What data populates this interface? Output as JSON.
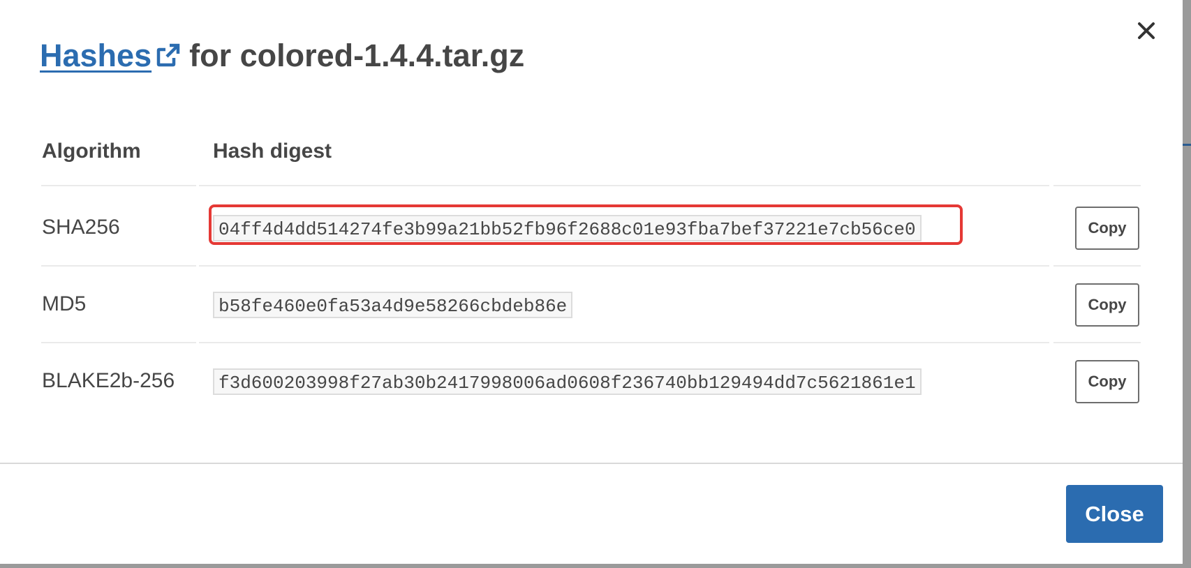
{
  "modal": {
    "title_link": "Hashes",
    "title_rest": "for colored-1.4.4.tar.gz",
    "close_icon": "close-icon",
    "external_link_icon": "external-link-icon"
  },
  "table": {
    "headers": [
      "Algorithm",
      "Hash digest"
    ],
    "rows": [
      {
        "algorithm": "SHA256",
        "digest": "04ff4d4dd514274fe3b99a21bb52fb96f2688c01e93fba7bef37221e7cb56ce0",
        "copy_label": "Copy",
        "highlighted": true
      },
      {
        "algorithm": "MD5",
        "digest": "b58fe460e0fa53a4d9e58266cbdeb86e",
        "copy_label": "Copy",
        "highlighted": false
      },
      {
        "algorithm": "BLAKE2b-256",
        "digest": "f3d600203998f27ab30b2417998006ad0608f236740bb129494dd7c5621861e1",
        "copy_label": "Copy",
        "highlighted": false
      }
    ]
  },
  "footer": {
    "close_label": "Close"
  },
  "colors": {
    "accent": "#2b6cb0",
    "highlight": "#e53935",
    "text": "#464646"
  }
}
